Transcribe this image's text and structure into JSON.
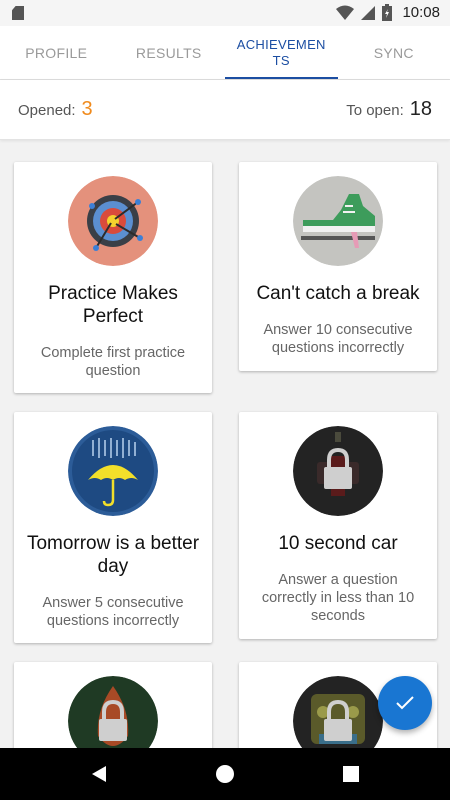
{
  "status_bar": {
    "time": "10:08"
  },
  "tabs": [
    {
      "label": "PROFILE",
      "active": false
    },
    {
      "label": "RESULTS",
      "active": false
    },
    {
      "label": "ACHIEVEMENTS",
      "active": true
    },
    {
      "label": "SYNC",
      "active": false
    }
  ],
  "counters": {
    "opened_label": "Opened:",
    "opened_value": "3",
    "to_open_label": "To open:",
    "to_open_value": "18"
  },
  "achievements": [
    {
      "title": "Practice Makes Perfect",
      "description": "Complete first practice question",
      "icon": "target-darts-icon",
      "locked": false
    },
    {
      "title": "Can't catch a break",
      "description": "Answer 10 consecutive questions incorrectly",
      "icon": "sneaker-icon",
      "locked": false
    },
    {
      "title": "Tomorrow is a better day",
      "description": "Answer 5 consecutive questions incorrectly",
      "icon": "umbrella-rain-icon",
      "locked": false
    },
    {
      "title": "10 second car",
      "description": "Answer a question correctly in less than 10 seconds",
      "icon": "race-car-lock-icon",
      "locked": true
    },
    {
      "title": "",
      "description": "",
      "icon": "flame-lock-icon",
      "locked": true
    },
    {
      "title": "",
      "description": "",
      "icon": "robot-lock-icon",
      "locked": true
    }
  ],
  "colors": {
    "accent": "#1c4ea2",
    "opened": "#f08a1c",
    "fab": "#1976d2"
  }
}
